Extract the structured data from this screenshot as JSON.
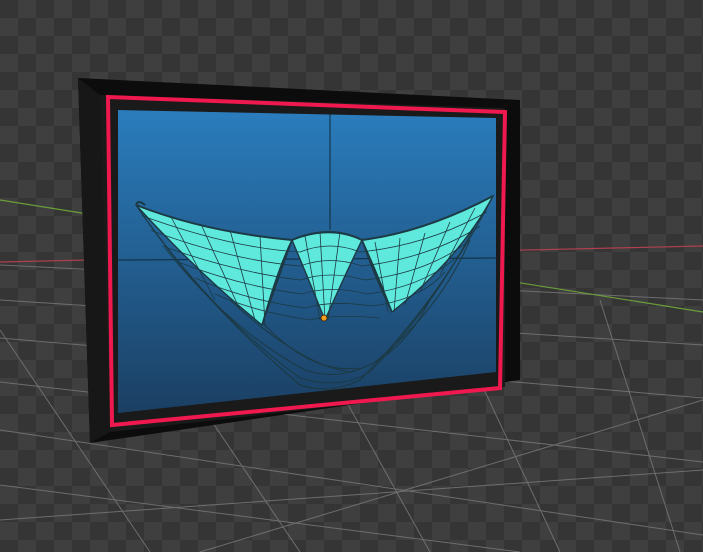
{
  "viewport": {
    "background_color": "#3c3c3c",
    "checker_dark": "#353535",
    "checker_light": "#3f3f3f",
    "grid_color": "#777777",
    "axis_x_color": "#b04050",
    "axis_y_color": "#6b9e3a"
  },
  "scene": {
    "objects": [
      {
        "name": "frame",
        "color": "#0c0c0c",
        "highlight_color": "#f0194f"
      },
      {
        "name": "screen",
        "gradient_top": "#2a7dbd",
        "gradient_bottom": "#1b3f63"
      },
      {
        "name": "mesh-surface",
        "fill_color": "#5fe8dc",
        "wire_color": "#1c3a44"
      },
      {
        "name": "origin-point",
        "color": "#f0a020",
        "selected": true
      }
    ]
  }
}
